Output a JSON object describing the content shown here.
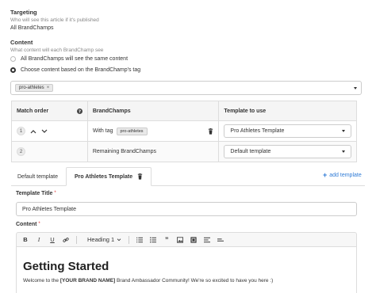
{
  "targeting": {
    "title": "Targeting",
    "hint": "Who will see this article if it's published",
    "value": "All BrandChamps"
  },
  "content": {
    "title": "Content",
    "hint": "What content will each BrandChamp see",
    "options": [
      {
        "label": "All BrandChamps will see the same content",
        "selected": false
      },
      {
        "label": "Choose content based on the BrandChamp's tag",
        "selected": true
      }
    ]
  },
  "tag_select": {
    "tags": [
      "pro-athletes"
    ],
    "remove_glyph": "×"
  },
  "rules_table": {
    "headers": [
      "Match order",
      "BrandChamps",
      "Template to use"
    ],
    "rows": [
      {
        "order": "1",
        "brandchamps": "With tag",
        "tag": "pro-athletes",
        "template": "Pro Athletes Template"
      },
      {
        "order": "2",
        "brandchamps": "Remaining BrandChamps",
        "tag": "",
        "template": "Default template"
      }
    ]
  },
  "tabs": {
    "items": [
      "Default template",
      "Pro Athletes Template"
    ],
    "active_index": 1,
    "add_label": "add template"
  },
  "template_form": {
    "title_label": "Template Title",
    "title_value": "Pro Athletes Template",
    "content_label": "Content",
    "required_mark": "*"
  },
  "editor": {
    "heading_select": "Heading 1",
    "heading_text": "Getting Started",
    "body_prefix": "Welcome to the ",
    "body_bold": "[YOUR BRAND NAME]",
    "body_suffix": " Brand Ambassador Community! We're so excited to have you here :)"
  },
  "colors": {
    "accent": "#2f7bd6",
    "required": "#d33333",
    "border": "#dddddd"
  },
  "icons": {
    "help": "question-circle-icon",
    "up": "chevron-up-icon",
    "down": "chevron-down-icon",
    "trash": "trash-icon",
    "plus": "plus-icon"
  }
}
